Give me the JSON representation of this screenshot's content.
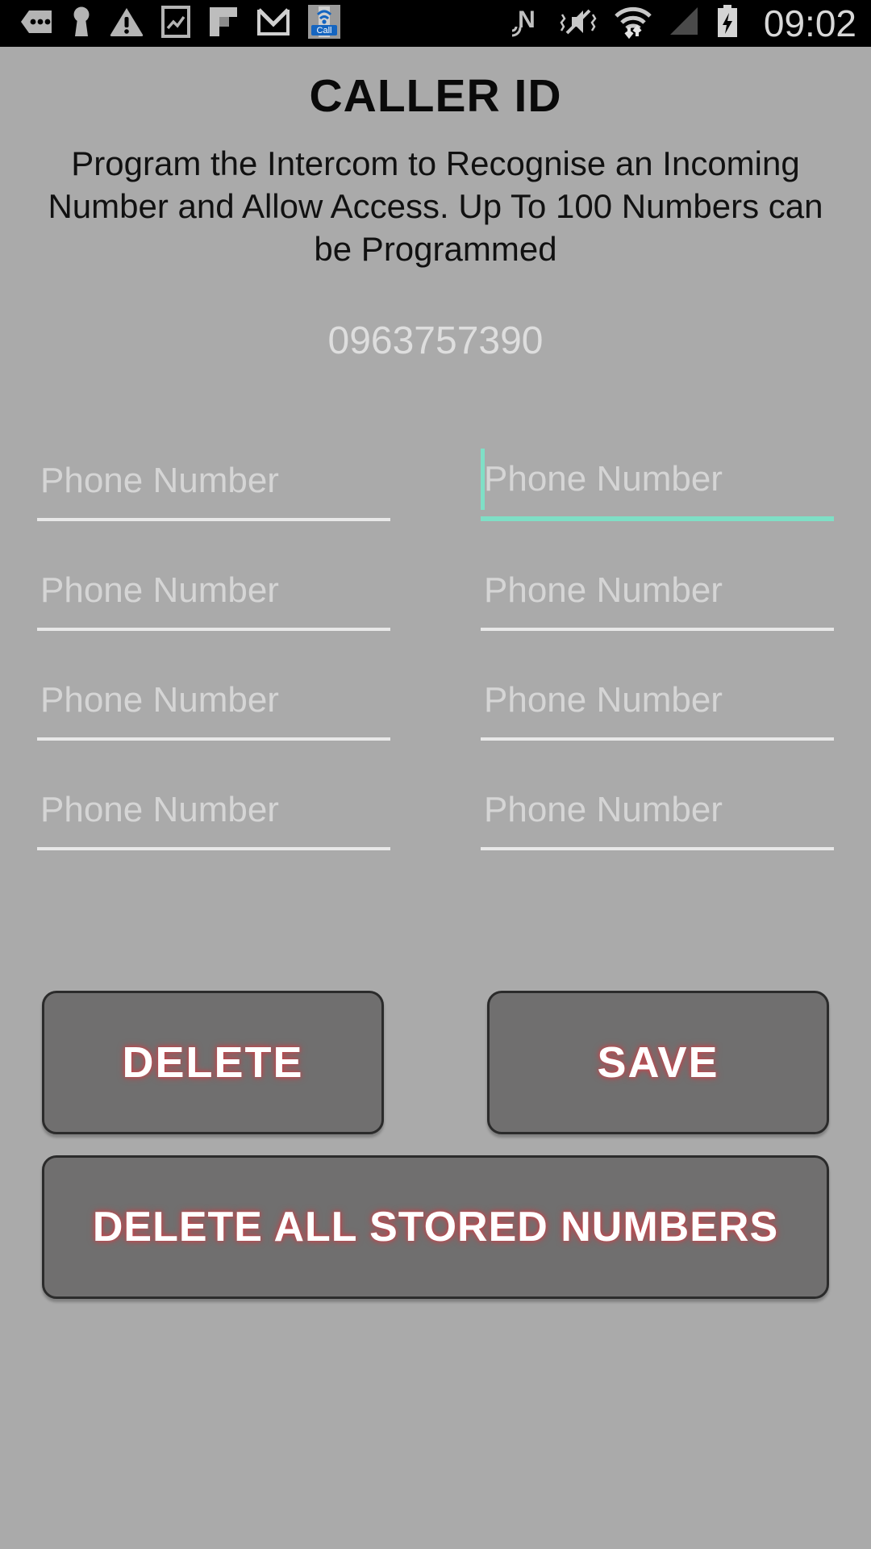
{
  "status_bar": {
    "time": "09:02",
    "left_icons": [
      {
        "name": "more-options-icon",
        "glyph": "dots-tag"
      },
      {
        "name": "keyhole-vpn-icon",
        "glyph": "keyhole"
      },
      {
        "name": "warning-triangle-icon",
        "glyph": "warning"
      },
      {
        "name": "screenshot-image-icon",
        "glyph": "photo"
      },
      {
        "name": "flipboard-icon",
        "glyph": "flipboard"
      },
      {
        "name": "gmail-icon",
        "glyph": "gmail"
      },
      {
        "name": "call-app-icon",
        "glyph": "call-badge"
      }
    ],
    "right_icons": [
      {
        "name": "nfc-icon",
        "glyph": "nfc-n"
      },
      {
        "name": "mute-vibrate-icon",
        "glyph": "mute"
      },
      {
        "name": "wifi-icon",
        "glyph": "wifi-arrows"
      },
      {
        "name": "cellular-signal-icon",
        "glyph": "signal"
      },
      {
        "name": "battery-charging-icon",
        "glyph": "battery-bolt"
      }
    ]
  },
  "header": {
    "title": "CALLER ID",
    "description": "Program the Intercom to Recognise an Incoming Number and Allow Access. Up To 100 Numbers can be Programmed"
  },
  "stored_number": "0963757390",
  "form": {
    "placeholder": "Phone Number",
    "focused_index": 1,
    "fields": [
      {
        "value": "",
        "placeholder": "Phone Number",
        "focused": false
      },
      {
        "value": "",
        "placeholder": "Phone Number",
        "focused": true
      },
      {
        "value": "",
        "placeholder": "Phone Number",
        "focused": false
      },
      {
        "value": "",
        "placeholder": "Phone Number",
        "focused": false
      },
      {
        "value": "",
        "placeholder": "Phone Number",
        "focused": false
      },
      {
        "value": "",
        "placeholder": "Phone Number",
        "focused": false
      },
      {
        "value": "",
        "placeholder": "Phone Number",
        "focused": false
      },
      {
        "value": "",
        "placeholder": "Phone Number",
        "focused": false
      }
    ]
  },
  "buttons": {
    "delete": "DELETE",
    "save": "SAVE",
    "delete_all": "DELETE ALL STORED NUMBERS"
  },
  "colors": {
    "background": "#AAAAAA",
    "status_bar_bg": "#000000",
    "accent_focus": "#7FDFC6",
    "underline": "#E8E8E8",
    "placeholder_text": "#D5D5D5",
    "button_bg": "#706F6F",
    "button_border": "#2B2B2B",
    "button_text": "#FFFFFF",
    "button_glow": "#C8434A",
    "title_text": "#0A0A0A",
    "stored_number_text": "#DEDEDE",
    "clock_text": "#D8D8D8"
  }
}
